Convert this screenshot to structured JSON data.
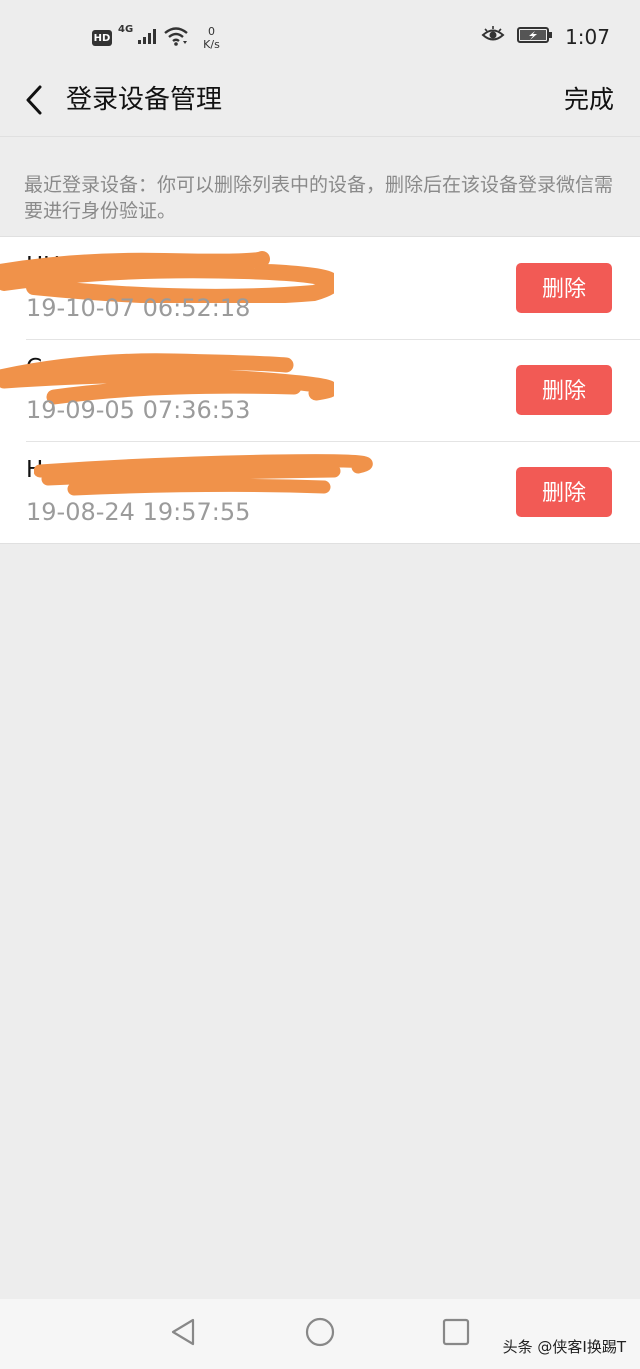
{
  "status_bar": {
    "hd_badge": "HD",
    "network_type": "4G",
    "speed_value": "0",
    "speed_unit": "K/s",
    "time": "1:07",
    "icons": [
      "hd-icon",
      "signal-icon",
      "wifi-icon",
      "eye-comfort-icon",
      "battery-charging-icon"
    ]
  },
  "nav": {
    "title": "登录设备管理",
    "done_label": "完成",
    "back_icon": "chevron-left-icon"
  },
  "notice": "最近登录设备：你可以删除列表中的设备，删除后在该设备登录微信需要进行身份验证。",
  "devices": [
    {
      "name": "HUAWEI 00",
      "time": "19-10-07 06:52:18",
      "delete_label": "删除",
      "redacted": true
    },
    {
      "name": "C",
      "time": "19-09-05 07:36:53",
      "delete_label": "删除",
      "redacted": true
    },
    {
      "name": "Ho",
      "time": "19-08-24 19:57:55",
      "delete_label": "删除",
      "redacted": true
    }
  ],
  "system_nav": {
    "icons": [
      "back-triangle-icon",
      "home-circle-icon",
      "recents-square-icon"
    ],
    "watermark": "头条 @侠客I换踢T"
  },
  "colors": {
    "background": "#ededed",
    "list_background": "#ffffff",
    "delete_button": "#f25a55",
    "redaction_stroke": "#f0924a",
    "secondary_text": "#9b9b9b"
  }
}
